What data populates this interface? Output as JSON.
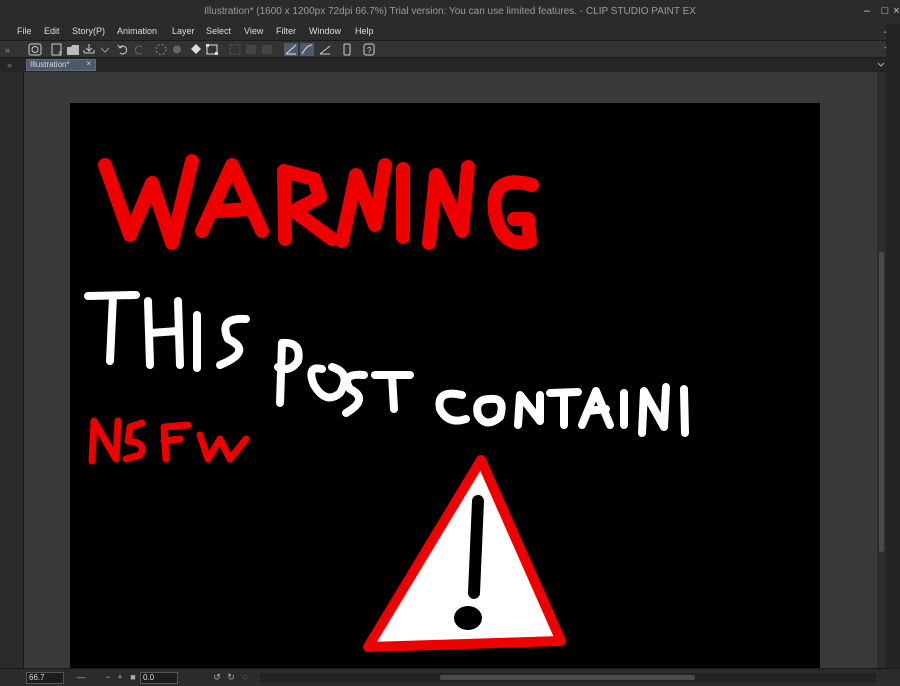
{
  "window": {
    "title": "Illustration* (1600 x 1200px 72dpi 66.7%)  Trial version: You can use limited features. - CLIP STUDIO PAINT EX"
  },
  "menu": {
    "items": [
      "File",
      "Edit",
      "Story(P)",
      "Animation",
      "Layer",
      "Select",
      "View",
      "Filter",
      "Window",
      "Help"
    ]
  },
  "tabs": [
    {
      "label": "Illustration*",
      "close": "×"
    }
  ],
  "toolbar": {
    "icons": [
      "clip-studio-icon",
      "new-icon",
      "open-icon",
      "save-icon",
      "export-icon",
      "undo-icon",
      "redo-icon",
      "clear-icon",
      "fill-icon",
      "transform-icon",
      "deselect-icon",
      "invert-icon",
      "expand-icon",
      "shrink-icon",
      "snap-ruler-icon",
      "snap-special-ruler-icon",
      "snap-grid-icon",
      "smartphone-icon",
      "help-icon"
    ]
  },
  "artwork": {
    "warning_text": "WARNING",
    "line1": "THIS POST CONTAIN",
    "nsfw": "NSFW",
    "symbol": "!",
    "colors": {
      "red": "#ee0000",
      "white": "#ffffff",
      "background": "#000000"
    }
  },
  "status": {
    "zoom": "66.7",
    "rotation": "0.0"
  }
}
